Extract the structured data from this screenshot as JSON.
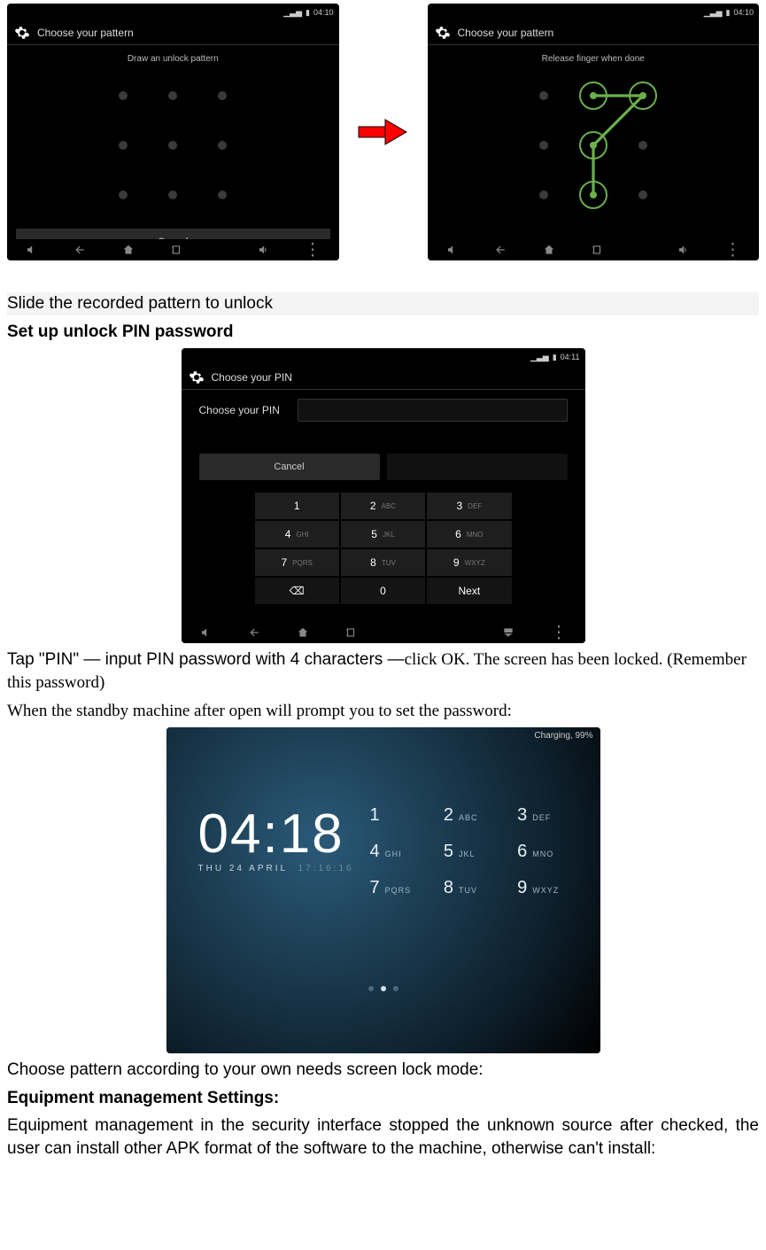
{
  "pattern_screen_title": "Choose your pattern",
  "pattern_draw_msg": "Draw an unlock pattern",
  "pattern_release_msg": "Release finger when done",
  "pattern_cancel": "Cancel",
  "status_time_1": "04:10",
  "pin_screen_title": "Choose your PIN",
  "pin_label": "Choose your PIN",
  "pin_cancel": "Cancel",
  "pin_next": "Next",
  "status_time_2": "04:11",
  "keypad": [
    {
      "n": "1",
      "s": ""
    },
    {
      "n": "2",
      "s": "ABC"
    },
    {
      "n": "3",
      "s": "DEF"
    },
    {
      "n": "4",
      "s": "GHI"
    },
    {
      "n": "5",
      "s": "JKL"
    },
    {
      "n": "6",
      "s": "MNO"
    },
    {
      "n": "7",
      "s": "PQRS"
    },
    {
      "n": "8",
      "s": "TUV"
    },
    {
      "n": "9",
      "s": "WXYZ"
    },
    {
      "n": "⌫",
      "s": ""
    },
    {
      "n": "0",
      "s": ""
    },
    {
      "n": "Next",
      "s": ""
    }
  ],
  "lock_charging": "Charging, 99%",
  "lock_time": "04:18",
  "lock_date": "THU 24 APRIL",
  "lock_sub": "17:16:16",
  "lock_keys": [
    {
      "n": "1",
      "s": ""
    },
    {
      "n": "2",
      "s": "ABC"
    },
    {
      "n": "3",
      "s": "DEF"
    },
    {
      "n": "4",
      "s": "GHI"
    },
    {
      "n": "5",
      "s": "JKL"
    },
    {
      "n": "6",
      "s": "MNO"
    },
    {
      "n": "7",
      "s": "PQRS"
    },
    {
      "n": "8",
      "s": "TUV"
    },
    {
      "n": "9",
      "s": "WXYZ"
    }
  ],
  "text": {
    "slide": "Slide the recorded pattern to unlock",
    "setup_pin": "Set up unlock PIN password",
    "tap_pin_a": "Tap \"PIN\" — input PIN password with 4 characters —",
    "tap_pin_b": "click OK. The screen has been locked. (Remember this password)",
    "standby": "When the standby machine after open will prompt you to set the password:",
    "choose_pattern": "Choose pattern according to your own needs screen lock mode:",
    "equip_head": "Equipment management Settings:",
    "equip_body": "Equipment management in the security interface stopped the unknown source after checked, the user can install other APK format of the software to the machine, otherwise can't install:"
  }
}
